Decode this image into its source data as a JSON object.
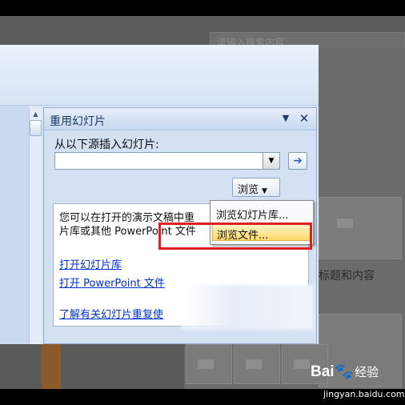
{
  "background": {
    "search_placeholder": "请输入搜索内容",
    "layout_label": "标题和内容"
  },
  "task_pane": {
    "title": "重用幻灯片",
    "insert_from_label": "从以下源插入幻灯片:",
    "source_input_value": "",
    "go_arrow": "➔",
    "browse_label": "浏览",
    "info_line1": "您可以在打开的演示文稿中重",
    "info_line2": "片库或其他 PowerPoint 文件",
    "link_open_library": "打开幻灯片库",
    "link_open_ppt": "打开 PowerPoint 文件",
    "link_learn_more": "了解有关幻灯片重复使"
  },
  "browse_menu": {
    "items": [
      {
        "label": "浏览幻灯片库..."
      },
      {
        "label": "浏览文件...",
        "highlighted": true
      }
    ]
  },
  "watermark": {
    "brand": "Bai",
    "brand_suffix": "经验",
    "url": "jingyan.baidu.com"
  },
  "colors": {
    "pane_bg": "#d3e1f3",
    "highlight": "#ffd86b",
    "annotation_red": "#e02020",
    "link": "#0033cc"
  }
}
